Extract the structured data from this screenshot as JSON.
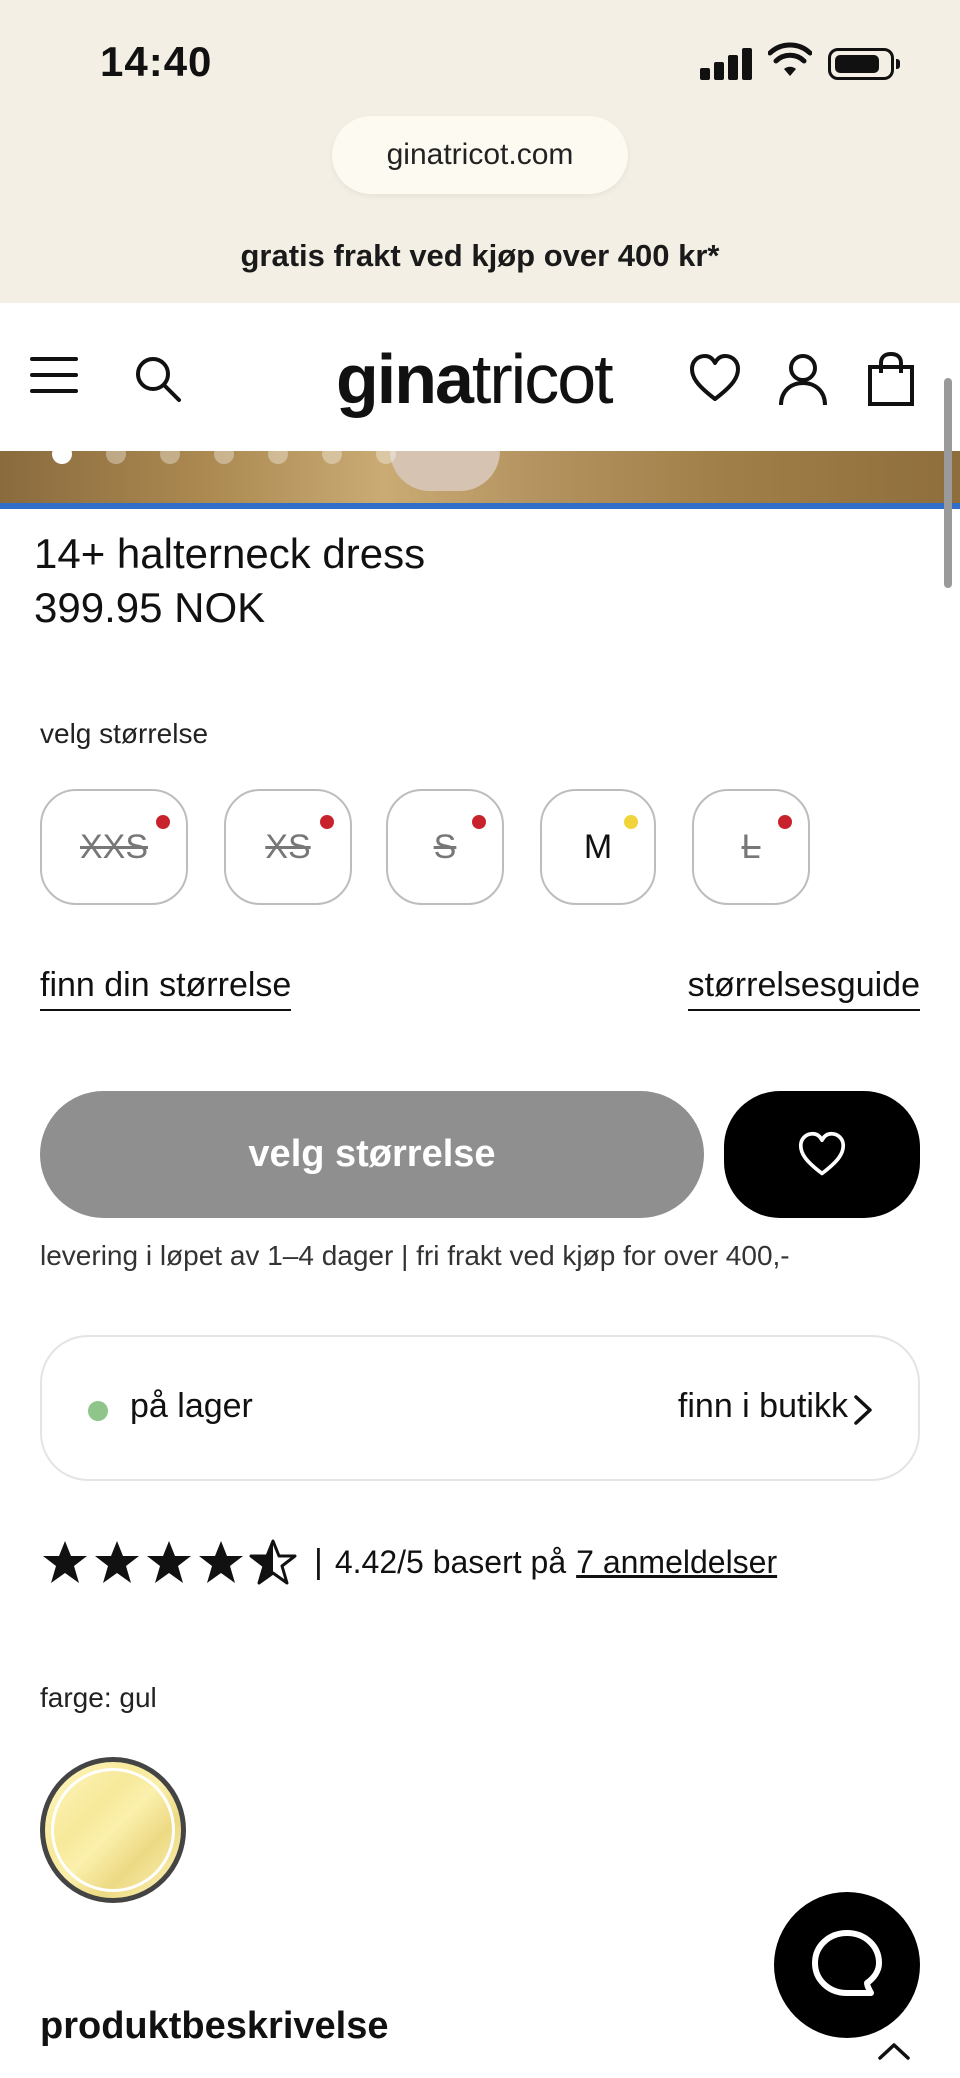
{
  "status_bar": {
    "time": "14:40"
  },
  "browser": {
    "url": "ginatricot.com"
  },
  "promo_banner": "gratis frakt ved kjøp over 400 kr*",
  "header": {
    "logo_bold": "gina",
    "logo_regular": "tricot"
  },
  "gallery": {
    "dot_count": 7,
    "active_dot": 1
  },
  "product": {
    "title": "14+ halterneck dress",
    "price": "399.95 NOK"
  },
  "size_selector": {
    "label": "velg størrelse",
    "sizes": [
      {
        "label": "XXS",
        "available": false,
        "indicator_color": "#c8232c"
      },
      {
        "label": "XS",
        "available": false,
        "indicator_color": "#c8232c"
      },
      {
        "label": "S",
        "available": false,
        "indicator_color": "#c8232c"
      },
      {
        "label": "M",
        "available": true,
        "indicator_color": "#f0d43a"
      },
      {
        "label": "L",
        "available": false,
        "indicator_color": "#c8232c"
      }
    ],
    "find_size_link": "finn din størrelse",
    "size_guide_link": "størrelsesguide"
  },
  "actions": {
    "add_button_label": "velg størrelse",
    "delivery_info": "levering i løpet av 1–4 dager | fri frakt ved kjøp for over 400,-"
  },
  "stock": {
    "status": "på lager",
    "status_color": "#8fc48a",
    "find_in_store": "finn i butikk"
  },
  "rating": {
    "stars": 4.42,
    "separator": "|",
    "score_text": "4.42/5 basert på",
    "reviews_link": "7 anmeldelser"
  },
  "color": {
    "label": "farge: gul",
    "selected_swatch": "yellow-swatch"
  },
  "description": {
    "title": "produktbeskrivelse"
  },
  "colors": {
    "accent_blue": "#2f6fc9",
    "cta_gray": "#8f8f8f",
    "black": "#000000",
    "top_bg": "#f3efe4"
  }
}
